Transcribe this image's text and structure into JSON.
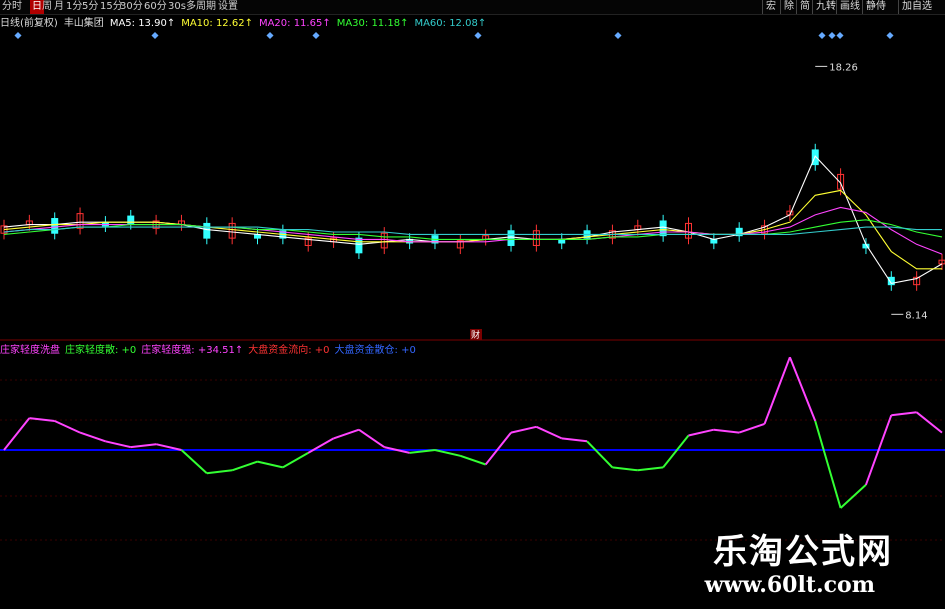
{
  "toolbar": {
    "left_items": [
      "分时",
      "日",
      "周",
      "月",
      "1分",
      "5分",
      "15分",
      "30分",
      "60分",
      "30s",
      "多周期",
      "设置"
    ],
    "left_icons": [
      "chevron-left-icon",
      "calendar-icon",
      "clock-icon",
      "clock-icon",
      "clock-icon",
      "clock-icon",
      "clock-icon",
      "clock-icon",
      "clock-icon",
      "clock-icon",
      "grid-icon",
      "gear-icon"
    ],
    "active_index": 1,
    "right_items": [
      "宏",
      "除",
      "简",
      "九转",
      "画线",
      "静侍",
      "加自选"
    ]
  },
  "ma_row": {
    "prefix": "日线(前复权)",
    "stock": "丰山集团",
    "items": [
      {
        "label": "MA5: 13.90↑",
        "color": "#ffffff"
      },
      {
        "label": "MA10: 12.62↑",
        "color": "#ffff33"
      },
      {
        "label": "MA20: 11.65↑",
        "color": "#ff44ff"
      },
      {
        "label": "MA30: 11.18↑",
        "color": "#33ff33"
      },
      {
        "label": "MA60: 12.08↑",
        "color": "#33cccc"
      }
    ]
  },
  "indicator_row": {
    "items": [
      {
        "label": "庄家轻度洗盘",
        "color": "#ff44ff"
      },
      {
        "label": "庄家轻度散: +0",
        "color": "#33ff33"
      },
      {
        "label": "庄家轻度强: +34.51↑",
        "color": "#ff44ff"
      },
      {
        "label": "大盘资金流向: +0",
        "color": "#ff3333"
      },
      {
        "label": "大盘资金散仓: +0",
        "color": "#3366ff"
      }
    ]
  },
  "annotations": {
    "high_label": "18.26",
    "low_label": "8.14",
    "marker": "财"
  },
  "watermark": {
    "cn": "乐淘公式网",
    "url": "www.60lt.com"
  },
  "colors": {
    "up": "#ff3333",
    "down": "#33ffff",
    "ma5": "#ffffff",
    "ma10": "#ffff33",
    "ma20": "#ff44ff",
    "ma30": "#33ff33",
    "ma60": "#33cccc",
    "baseline": "#0000ff",
    "osc_pos": "#ff44ff",
    "osc_neg": "#33ff33",
    "grid": "#7a0000",
    "dot": "#66aaff"
  },
  "chart_data": [
    {
      "type": "line",
      "title": "丰山集团 日线(前复权)",
      "ylim": [
        7.5,
        19.5
      ],
      "grid": true,
      "series": [
        {
          "name": "MA5",
          "values": [
            11.7,
            11.8,
            11.8,
            11.9,
            11.9,
            11.9,
            11.9,
            11.8,
            11.6,
            11.5,
            11.4,
            11.3,
            11.2,
            11.1,
            11.0,
            11.1,
            11.2,
            11.1,
            11.1,
            11.2,
            11.3,
            11.2,
            11.2,
            11.3,
            11.5,
            11.6,
            11.7,
            11.5,
            11.2,
            11.4,
            11.7,
            12.2,
            14.6,
            13.5,
            11.0,
            9.4,
            9.6,
            10.2
          ]
        },
        {
          "name": "MA10",
          "values": [
            11.6,
            11.7,
            11.8,
            11.8,
            11.9,
            11.9,
            11.9,
            11.8,
            11.7,
            11.6,
            11.5,
            11.4,
            11.3,
            11.2,
            11.1,
            11.1,
            11.1,
            11.1,
            11.1,
            11.2,
            11.2,
            11.2,
            11.2,
            11.3,
            11.4,
            11.5,
            11.6,
            11.5,
            11.4,
            11.4,
            11.6,
            11.9,
            13.0,
            13.2,
            12.2,
            10.7,
            10.0,
            10.0
          ]
        },
        {
          "name": "MA20",
          "values": [
            11.5,
            11.6,
            11.7,
            11.8,
            11.8,
            11.8,
            11.8,
            11.8,
            11.7,
            11.7,
            11.6,
            11.5,
            11.4,
            11.3,
            11.2,
            11.2,
            11.1,
            11.1,
            11.1,
            11.1,
            11.2,
            11.2,
            11.2,
            11.2,
            11.3,
            11.4,
            11.5,
            11.5,
            11.4,
            11.4,
            11.5,
            11.7,
            12.2,
            12.5,
            12.3,
            11.6,
            11.0,
            10.6
          ]
        },
        {
          "name": "MA30",
          "values": [
            11.4,
            11.5,
            11.6,
            11.7,
            11.7,
            11.8,
            11.8,
            11.8,
            11.7,
            11.7,
            11.6,
            11.6,
            11.5,
            11.4,
            11.4,
            11.3,
            11.3,
            11.2,
            11.2,
            11.2,
            11.2,
            11.2,
            11.2,
            11.2,
            11.3,
            11.3,
            11.4,
            11.4,
            11.4,
            11.4,
            11.4,
            11.5,
            11.7,
            11.9,
            12.0,
            11.8,
            11.5,
            11.3
          ]
        },
        {
          "name": "MA60",
          "values": [
            11.5,
            11.6,
            11.6,
            11.7,
            11.7,
            11.7,
            11.7,
            11.7,
            11.7,
            11.7,
            11.7,
            11.6,
            11.6,
            11.5,
            11.5,
            11.5,
            11.4,
            11.4,
            11.4,
            11.4,
            11.4,
            11.4,
            11.4,
            11.4,
            11.4,
            11.4,
            11.4,
            11.4,
            11.4,
            11.4,
            11.4,
            11.4,
            11.5,
            11.6,
            11.7,
            11.7,
            11.6,
            11.6
          ]
        }
      ]
    },
    {
      "type": "line",
      "ylim": [
        -1,
        1.6
      ],
      "series": [
        {
          "name": "庄家轻度强",
          "values": [
            0,
            0.55,
            0.5,
            0.3,
            0.15,
            0.05,
            0.1,
            0,
            -0.4,
            -0.35,
            -0.2,
            -0.3,
            -0.05,
            0.2,
            0.35,
            0.05,
            -0.05,
            0,
            -0.1,
            -0.25,
            0.3,
            0.4,
            0.2,
            0.15,
            -0.3,
            -0.35,
            -0.3,
            0.25,
            0.35,
            0.3,
            0.45,
            1.6,
            0.5,
            -1,
            -0.6,
            0.6,
            0.65,
            0.3
          ]
        }
      ]
    }
  ]
}
